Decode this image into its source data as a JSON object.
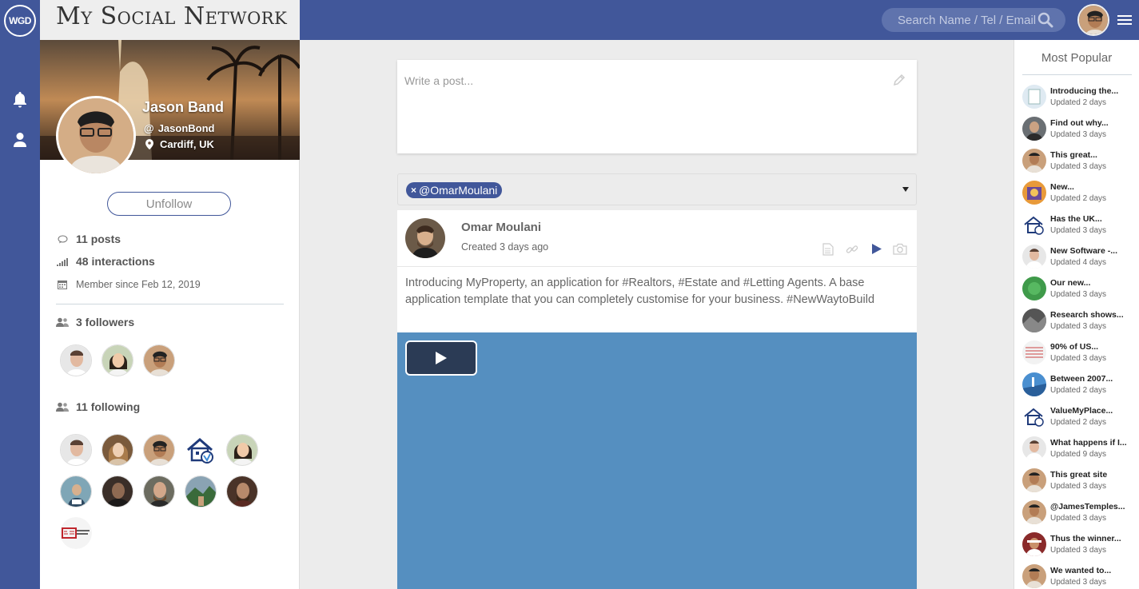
{
  "app": {
    "logo_text": "WGD",
    "title": "My Social Network"
  },
  "search": {
    "placeholder": "Search Name / Tel / Email"
  },
  "profile": {
    "name": "Jason Band",
    "handle": "JasonBond",
    "location": "Cardiff, UK",
    "unfollow_label": "Unfollow",
    "posts": "11 posts",
    "interactions": "48 interactions",
    "member_since": "Member since Feb 12, 2019",
    "followers_label": "3 followers",
    "following_label": "11 following"
  },
  "composer": {
    "placeholder": "Write a post..."
  },
  "filter": {
    "tag": "@OmarMoulani"
  },
  "post": {
    "author": "Omar Moulani",
    "created": "Created 3 days ago",
    "body": "Introducing MyProperty, an application for #Realtors, #Estate and #Letting Agents. A base application template that you can completely customise for your business. #NewWaytoBuild"
  },
  "popular": {
    "title": "Most Popular",
    "items": [
      {
        "title": "Introducing the...",
        "date": "Updated 2 days"
      },
      {
        "title": "Find out why...",
        "date": "Updated 3 days"
      },
      {
        "title": "This great...",
        "date": "Updated 3 days"
      },
      {
        "title": "New...",
        "date": "Updated 2 days"
      },
      {
        "title": "Has the UK...",
        "date": "Updated 3 days"
      },
      {
        "title": "New Software -...",
        "date": "Updated 4 days"
      },
      {
        "title": "Our new...",
        "date": "Updated 3 days"
      },
      {
        "title": "Research shows...",
        "date": "Updated 3 days"
      },
      {
        "title": "90% of US...",
        "date": "Updated 3 days"
      },
      {
        "title": "Between 2007...",
        "date": "Updated 2 days"
      },
      {
        "title": "ValueMyPlace...",
        "date": "Updated 2 days"
      },
      {
        "title": "What happens if I...",
        "date": "Updated 9 days"
      },
      {
        "title": "This great site",
        "date": "Updated 3 days"
      },
      {
        "title": "@JamesTemples...",
        "date": "Updated 3 days"
      },
      {
        "title": "Thus the winner...",
        "date": "Updated 3 days"
      },
      {
        "title": "We wanted to...",
        "date": "Updated 3 days"
      }
    ]
  },
  "colors": {
    "brand": "#41579a",
    "video_bg": "#558fc0",
    "play_button": "#2b3b55"
  }
}
